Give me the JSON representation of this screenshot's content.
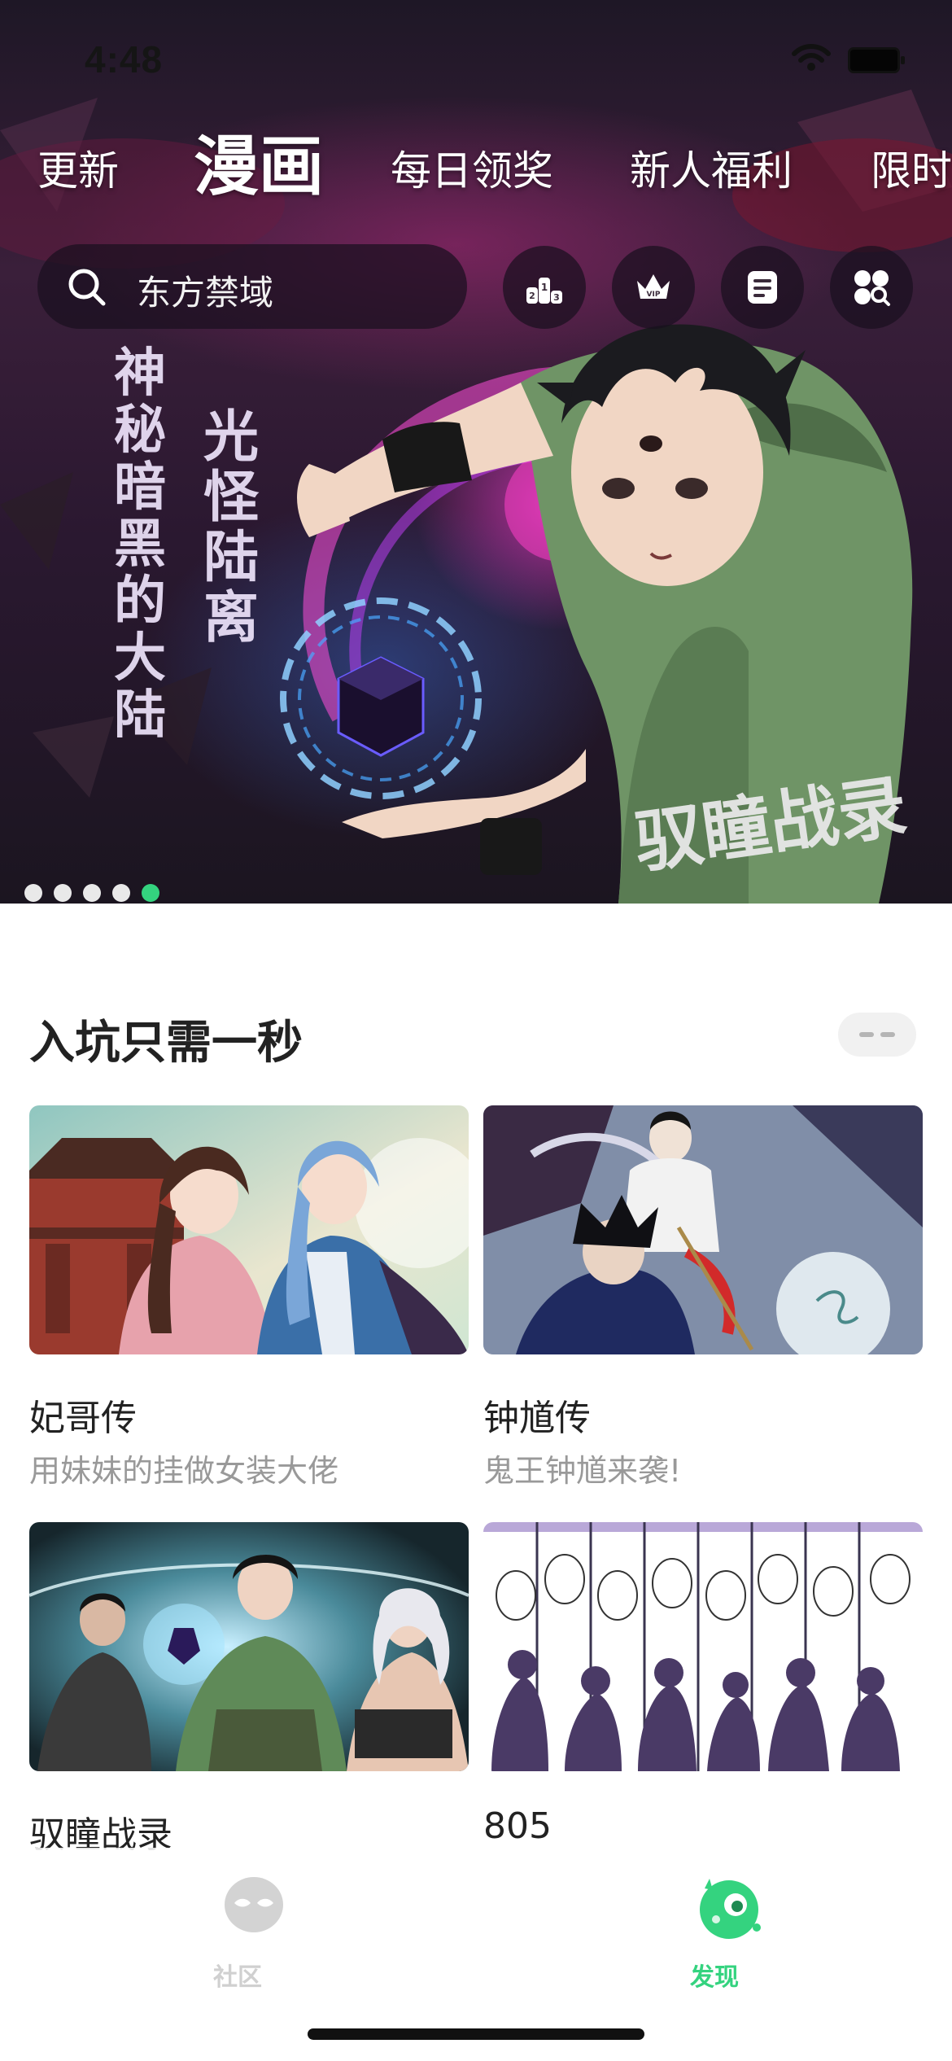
{
  "status_bar": {
    "time": "4:48"
  },
  "top_tabs": [
    {
      "label": "更新",
      "active": false
    },
    {
      "label": "漫画",
      "active": true
    },
    {
      "label": "每日领奖",
      "active": false
    },
    {
      "label": "新人福利",
      "active": false
    },
    {
      "label": "限时",
      "active": false
    }
  ],
  "search": {
    "placeholder": "东方禁域"
  },
  "quick_buttons": [
    {
      "icon": "ranking-icon"
    },
    {
      "icon": "vip-crown-icon"
    },
    {
      "icon": "list-icon"
    },
    {
      "icon": "category-icon"
    }
  ],
  "banner": {
    "artwork_text": [
      "神秘暗黑的大陆",
      "光怪陆离",
      "驭瞳战录"
    ],
    "slide_count": 5,
    "active_slide": 5
  },
  "section": {
    "title": "入坑只需一秒",
    "more_icon": "more-icon",
    "items": [
      {
        "title": "妃哥传",
        "subtitle": "用妹妹的挂做女装大佬"
      },
      {
        "title": "钟馗传",
        "subtitle": "鬼王钟馗来袭!"
      },
      {
        "title": "驭瞳战录",
        "subtitle": ""
      },
      {
        "title": "805",
        "subtitle": ""
      }
    ]
  },
  "bottom_nav": [
    {
      "label": "社区",
      "active": false,
      "icon": "community-icon"
    },
    {
      "label": "发现",
      "active": true,
      "icon": "discover-icon"
    }
  ],
  "colors": {
    "accent": "#34d37f",
    "inactive": "#d0d0d0",
    "text": "#222222",
    "subtext": "#999999"
  }
}
